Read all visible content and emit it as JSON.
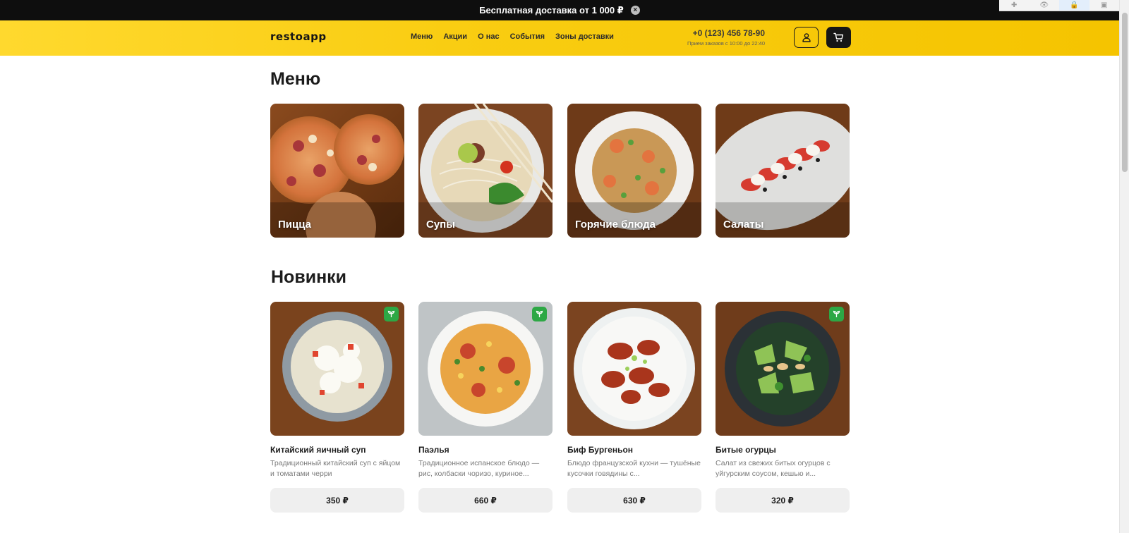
{
  "promo": {
    "text": "Бесплатная доставка от 1 000 ₽",
    "close_glyph": "×"
  },
  "header": {
    "logo": "restoapp",
    "nav": [
      "Меню",
      "Акции",
      "О нас",
      "События",
      "Зоны доставки"
    ],
    "phone": "+0 (123) 456 78-90",
    "phone_hours": "Прием заказов с 10:00 до 22:40",
    "icons": {
      "user": "user-icon",
      "cart": "cart-icon"
    },
    "accent": "#f9cd12"
  },
  "menu": {
    "title": "Меню",
    "categories": [
      {
        "label": "Пицца",
        "image": "pizza-image"
      },
      {
        "label": "Супы",
        "image": "soup-image"
      },
      {
        "label": "Горячие блюда",
        "image": "hot-dish-image"
      },
      {
        "label": "Салаты",
        "image": "salad-image"
      }
    ]
  },
  "new_items": {
    "title": "Новинки",
    "products": [
      {
        "name": "Китайский яичный суп",
        "desc": "Традиционный китайский суп с яйцом и томатами черри",
        "price": "350 ₽",
        "vegetarian": true
      },
      {
        "name": "Паэлья",
        "desc": "Традиционное испанское блюдо — рис, колбаски чоризо, куриное...",
        "price": "660 ₽",
        "vegetarian": true
      },
      {
        "name": "Биф Бургеньон",
        "desc": "Блюдо французской кухни — тушёные кусочки говядины с...",
        "price": "630 ₽",
        "vegetarian": false
      },
      {
        "name": "Битые огурцы",
        "desc": "Салат из свежих битых огурцов с уйгурским соусом, кешью и...",
        "price": "320 ₽",
        "vegetarian": true
      }
    ],
    "badge_color": "#2da845"
  }
}
